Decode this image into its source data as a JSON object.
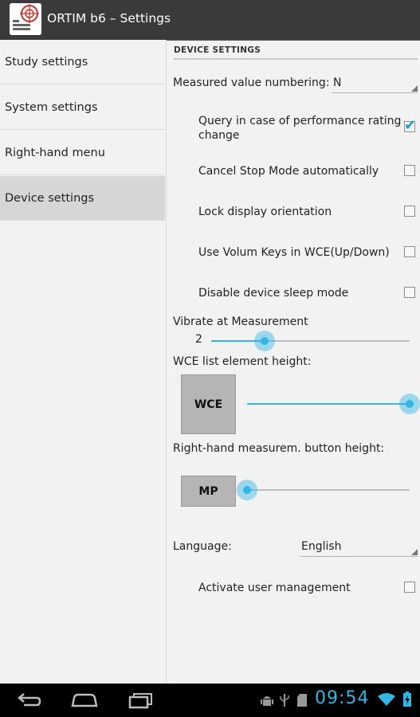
{
  "app": {
    "title": "ORTIM b6 – Settings"
  },
  "sidebar": {
    "items": [
      {
        "label": "Study settings"
      },
      {
        "label": "System settings"
      },
      {
        "label": "Right-hand menu"
      },
      {
        "label": "Device settings"
      }
    ]
  },
  "device_settings": {
    "header": "DEVICE SETTINGS",
    "numbering": {
      "label": "Measured value numbering:",
      "value": "N"
    },
    "checkboxes": [
      {
        "label_line1": "Query in case of performance rating",
        "label_line2": "change",
        "checked": true
      },
      {
        "label_line1": "Cancel Stop Mode automatically",
        "checked": false
      },
      {
        "label_line1": "Lock display orientation",
        "checked": false
      },
      {
        "label_line1": "Use Volum Keys in WCE(Up/Down)",
        "checked": false
      },
      {
        "label_line1": "Disable device sleep mode",
        "checked": false
      }
    ],
    "vibrate": {
      "label": "Vibrate at Measurement",
      "value": "2"
    },
    "wce_height": {
      "label": "WCE list element height:",
      "preview": "WCE"
    },
    "mp_height": {
      "label": "Right-hand measurem. button height:",
      "preview": "MP"
    },
    "language": {
      "label": "Language:",
      "value": "English"
    },
    "user_mgmt": {
      "label": "Activate user management",
      "checked": false
    }
  },
  "status_bar": {
    "time": "09:54"
  },
  "icons": {
    "app": "ortim-target-icon",
    "back": "back-icon",
    "home": "home-icon",
    "recents": "recent-apps-icon",
    "wifi": "wifi-icon",
    "battery": "battery-icon"
  },
  "colors": {
    "accent": "#33b5e5",
    "actionbar": "#3a3a3a",
    "selected": "#d6d6d6"
  }
}
